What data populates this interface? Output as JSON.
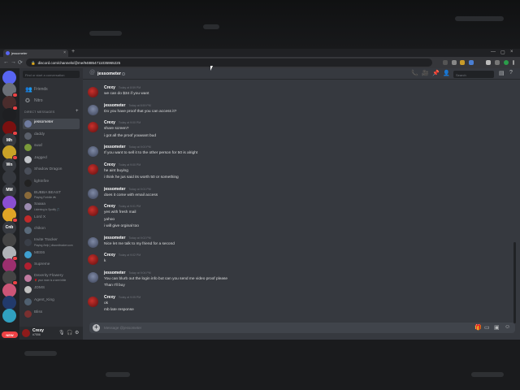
{
  "browser": {
    "tab_title": "jessometer",
    "tab_close": "×",
    "new_tab": "+",
    "url": "discord.com/channels/@me/948854711035965225",
    "window_controls": [
      "—",
      "▢",
      "×"
    ],
    "nav": [
      "←",
      "→",
      "⟳"
    ]
  },
  "guilds": {
    "items": [
      {
        "label": "",
        "color": "#5865f2",
        "icon": "discord-home-icon"
      },
      {
        "label": "",
        "color": "#6b6f77",
        "badge": ""
      },
      {
        "label": "",
        "color": "#4a2c2c",
        "badge": ""
      },
      {
        "label": "",
        "color": "#1e1f22"
      },
      {
        "label": "",
        "color": "#7a1010",
        "badge": ""
      },
      {
        "label": "Mh",
        "color": "#36393f"
      },
      {
        "label": "",
        "color": "#c9a227",
        "badge": ""
      },
      {
        "label": "Wn",
        "color": "#36393f"
      },
      {
        "label": "",
        "color": "#36393f"
      },
      {
        "label": "MM",
        "color": "#36393f"
      },
      {
        "label": "",
        "color": "#8a4fd1"
      },
      {
        "label": "",
        "color": "#e0a526",
        "badge": ""
      },
      {
        "label": "Cnb",
        "color": "#36393f"
      },
      {
        "label": "",
        "color": "#444"
      },
      {
        "label": "",
        "color": "#b0b3b8",
        "badge": ""
      },
      {
        "label": "",
        "color": "#9c2f6e"
      },
      {
        "label": "",
        "color": "#444",
        "badge": ""
      },
      {
        "label": "",
        "color": "#cc5577"
      },
      {
        "label": "",
        "color": "#223a6b"
      },
      {
        "label": "",
        "color": "#30a0c0"
      }
    ],
    "new_label": "NEW"
  },
  "dm_sidebar": {
    "search_placeholder": "Find or start a conversation",
    "friends_label": "Friends",
    "nitro_label": "Nitro",
    "header": "DIRECT MESSAGES",
    "add": "+",
    "items": [
      {
        "name": "jessometer",
        "sub": "",
        "color": "#6f7ba0",
        "active": true
      },
      {
        "name": "daddy",
        "sub": "",
        "color": "#5a5f6a"
      },
      {
        "name": "swaf",
        "sub": "",
        "color": "#7a9a3a"
      },
      {
        "name": "Jagged",
        "sub": "",
        "color": "#c0c3c8"
      },
      {
        "name": "Shadow Dragon",
        "sub": "",
        "color": "#4a4f5a"
      },
      {
        "name": "lightnfire",
        "sub": "",
        "color": "#222"
      },
      {
        "name": "BUBBA BEAST",
        "sub": "Playing Fortnite 🎮",
        "color": "#8a6a3a"
      },
      {
        "name": "Saaaa",
        "sub": "Listening to Spotify 🎵",
        "color": "#9b8bb0"
      },
      {
        "name": "Lord X",
        "sub": "",
        "color": "#c02a2a"
      },
      {
        "name": "chikon",
        "sub": "",
        "color": "#5a6a7a"
      },
      {
        "name": "Invite Tracker",
        "sub": "Playing /help | discordtracker.com",
        "color": "#3a3f48"
      },
      {
        "name": "MEE6",
        "sub": "",
        "color": "#3fa0d0"
      },
      {
        "name": "Supreme",
        "sub": "",
        "color": "#b02030"
      },
      {
        "name": "Dexerity Flowery",
        "sub": "🌹 your mom is a wee bittle",
        "color": "#c07aa0"
      },
      {
        "name": "JDMS",
        "sub": "",
        "color": "#c0c0c0"
      },
      {
        "name": "Agent_King",
        "sub": "",
        "color": "#506070"
      },
      {
        "name": "Bliss",
        "sub": "",
        "color": "#7a3030"
      }
    ]
  },
  "user_panel": {
    "name": "Crexy",
    "tag": "#7556"
  },
  "chat": {
    "recipient": "jessometer",
    "search_placeholder": "Search",
    "composer_placeholder": "Message @jessometer",
    "messages": [
      {
        "author": "Crexy",
        "time": "Today at 8:59 PM",
        "avatar": "crexy",
        "lines": [
          "we can do $34 if you want"
        ]
      },
      {
        "author": "jessometer",
        "time": "Today at 8:59 PM",
        "avatar": "jess",
        "lines": [
          "Do you have proof that you can access it?"
        ]
      },
      {
        "author": "Crexy",
        "time": "Today at 9:00 PM",
        "avatar": "crexy",
        "lines": [
          "share screen?",
          "i got all the proof youwant bud"
        ]
      },
      {
        "author": "jessometer",
        "time": "Today at 9:00 PM",
        "avatar": "jess",
        "lines": [
          "If you want to sell it to the other person for 50 is alright"
        ]
      },
      {
        "author": "Crexy",
        "time": "Today at 9:00 PM",
        "avatar": "crexy",
        "lines": [
          "he aint buying",
          "i think he jus said its worth 50 or something"
        ]
      },
      {
        "author": "jessometer",
        "time": "Today at 9:01 PM",
        "avatar": "jess",
        "lines": [
          "does it come with email access"
        ]
      },
      {
        "author": "Crexy",
        "time": "Today at 9:01 PM",
        "avatar": "crexy",
        "lines": [
          "yes with fresh mail",
          "yahoo",
          "i will give orginal too"
        ]
      },
      {
        "author": "jessometer",
        "time": "Today at 9:02 PM",
        "avatar": "jess",
        "lines": [
          "Nice let me talk to my friend for a second"
        ]
      },
      {
        "author": "Crexy",
        "time": "Today at 9:02 PM",
        "avatar": "crexy",
        "lines": [
          "k"
        ]
      },
      {
        "author": "jessometer",
        "time": "Today at 9:04 PM",
        "avatar": "jess",
        "lines": [
          "You can blurb out the login info but can you send me video proof please",
          "Than I'll buy"
        ]
      },
      {
        "author": "Crexy",
        "time": "Today at 9:05 PM",
        "avatar": "crexy",
        "lines": [
          "ok",
          "mb late response"
        ]
      }
    ]
  },
  "colors": {
    "discord_blurple": "#5865f2",
    "bg_primary": "#36393f",
    "bg_secondary": "#2f3136",
    "bg_tertiary": "#202225",
    "danger": "#ed4245"
  }
}
